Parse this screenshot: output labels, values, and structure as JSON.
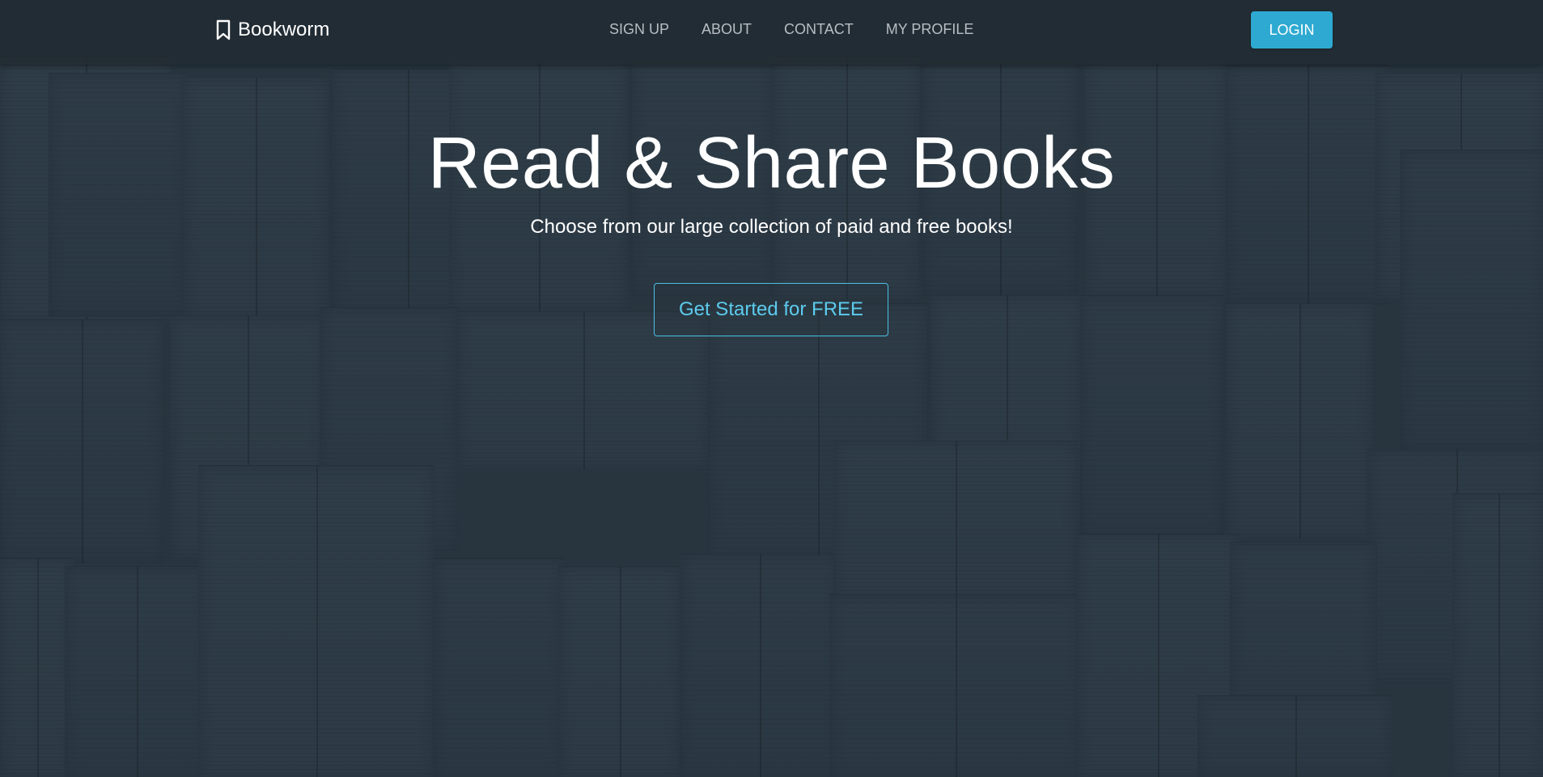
{
  "navbar": {
    "brand": {
      "label": "Bookworm",
      "icon": "bookmark-icon"
    },
    "links": [
      {
        "label": "SIGN UP"
      },
      {
        "label": "ABOUT"
      },
      {
        "label": "CONTACT"
      },
      {
        "label": "MY PROFILE"
      }
    ],
    "login_label": "LOGIN"
  },
  "hero": {
    "title": "Read & Share Books",
    "subtitle": "Choose from our large collection of paid and free books!",
    "cta_label": "Get Started for FREE"
  },
  "colors": {
    "accent": "#2eaad2",
    "cta_text": "#5ccbed",
    "background": "#2d3a44"
  }
}
